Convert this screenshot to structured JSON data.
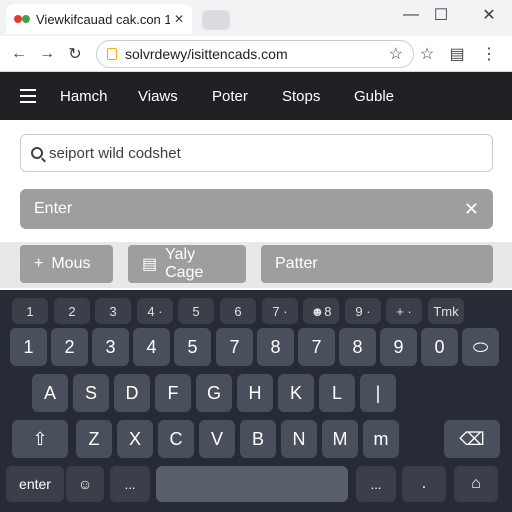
{
  "browser": {
    "tab_title": "Viewkifcauad cak.con 1",
    "tab_close": "✕",
    "window_controls": [
      "—",
      "☐",
      "✕"
    ],
    "url": "solvrdewy/isittencads.com",
    "nav_icons": [
      "back-icon",
      "forward-icon",
      "reload-icon"
    ],
    "right_icons": [
      "star-icon",
      "extension-icon",
      "tab-icon",
      "menu-icon"
    ]
  },
  "sitenav": {
    "items": [
      "Hamch",
      "Viaws",
      "Poter",
      "Stops",
      "Guble"
    ]
  },
  "search": {
    "value": "seiport wild codshet"
  },
  "enterbar": {
    "label": "Enter",
    "close": "✕"
  },
  "suggestions": [
    {
      "icon": "+",
      "label": "Mous"
    },
    {
      "icon": "▤",
      "label": "Yaly Cage"
    },
    {
      "icon": "",
      "label": "Patter"
    }
  ],
  "keyboard": {
    "hint_row": [
      "1",
      "2",
      "3",
      "4 ·",
      "5",
      "6",
      "7 ·",
      "☻8",
      "9 ·",
      "+ ·",
      "Tmk"
    ],
    "number_row": [
      "1",
      "2",
      "3",
      "4",
      "5",
      "7",
      "8",
      "7",
      "8",
      "9",
      "0",
      "⬭"
    ],
    "row_a": [
      "A",
      "S",
      "D",
      "F",
      "G",
      "H",
      "K",
      "L",
      "|"
    ],
    "row_z": [
      "⇧",
      "Z",
      "X",
      "C",
      "V",
      "B",
      "N",
      "M",
      "m",
      "⌫"
    ],
    "bottom": {
      "enter": "enter",
      "emoji": "☺",
      "dots": "...",
      "space": "",
      "sym": "...",
      "period": ".",
      "home": "⌂"
    }
  },
  "colors": {
    "nav_bg": "#202124",
    "keyboard_bg": "#262b35",
    "key_bg": "#4a505b",
    "chip_bg": "#9e9e9e"
  }
}
